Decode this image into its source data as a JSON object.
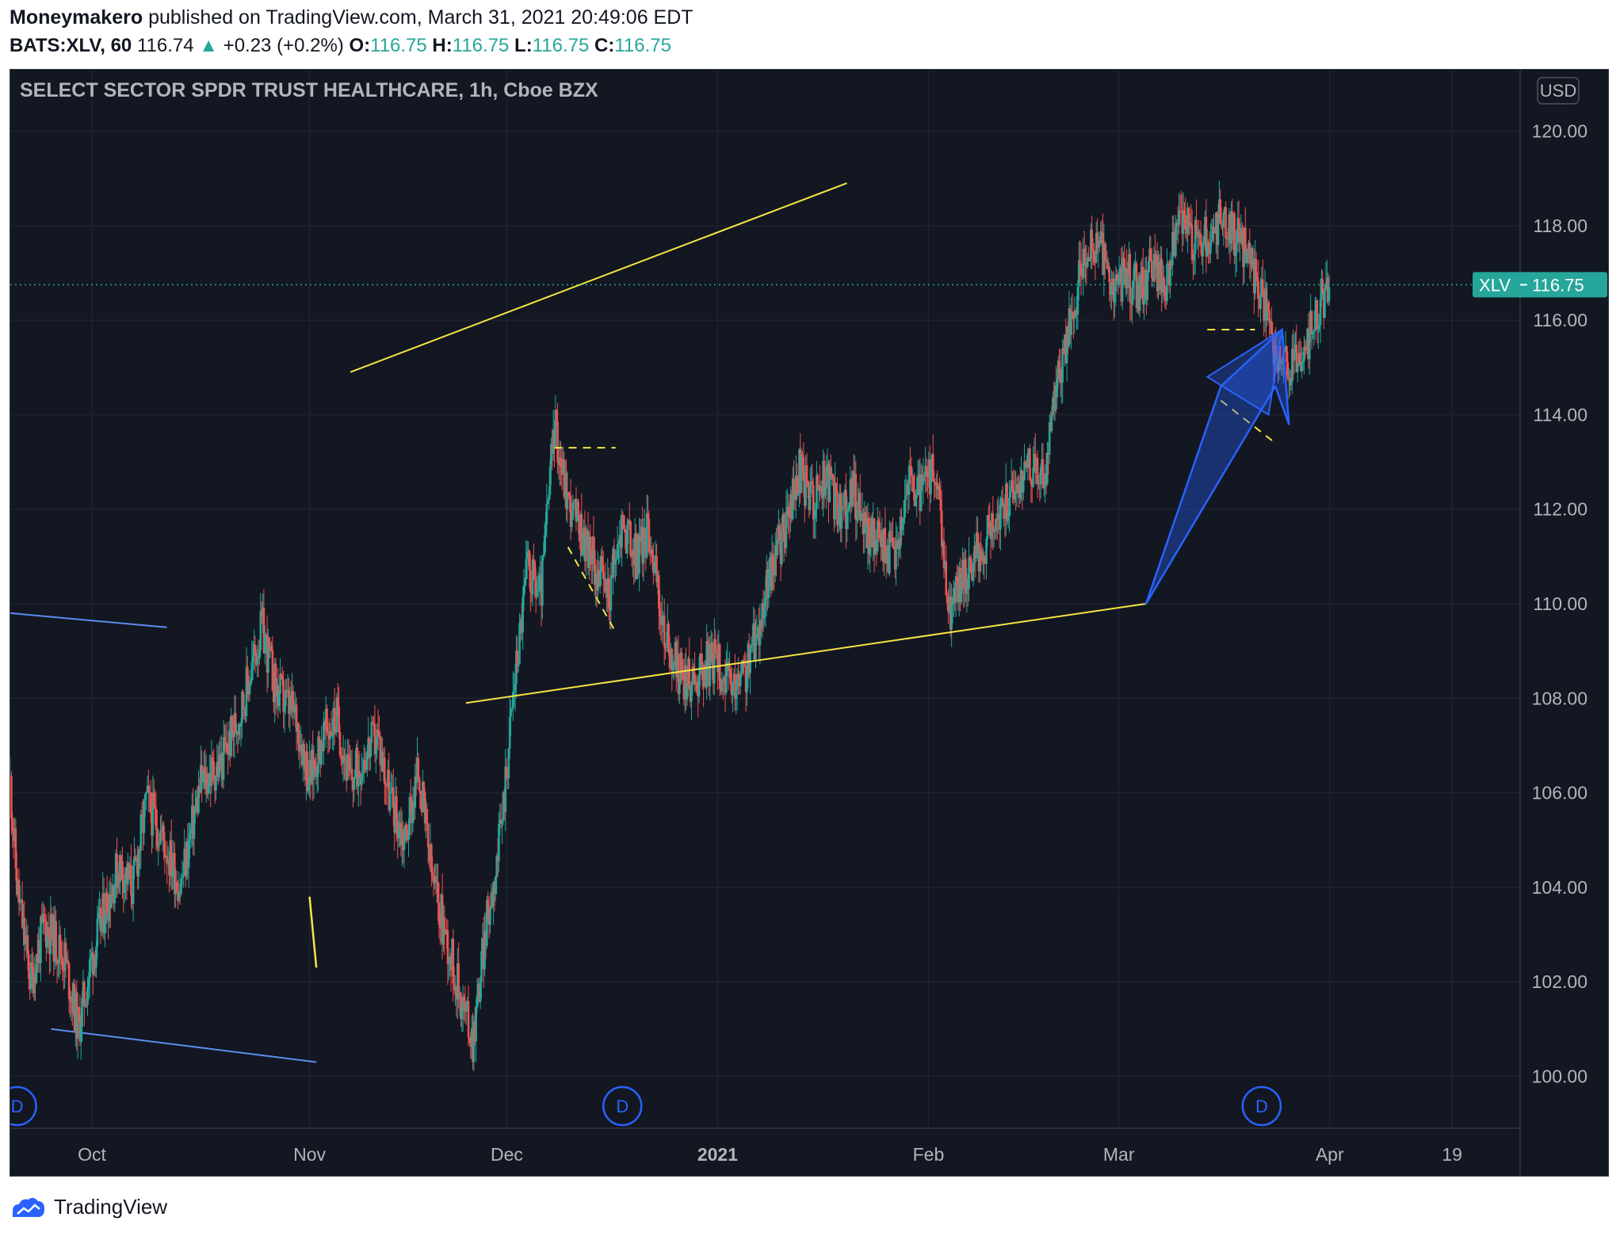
{
  "header": {
    "author": "Moneymakero",
    "published_text": "published on TradingView.com, March 31, 2021 20:49:06 EDT",
    "symbol": "BATS:XLV, 60",
    "last_price": "116.74",
    "change": "+0.23 (+0.2%)",
    "o_label": "O:",
    "o_value": "116.75",
    "h_label": "H:",
    "h_value": "116.75",
    "l_label": "L:",
    "l_value": "116.75",
    "c_label": "C:",
    "c_value": "116.75"
  },
  "footer": {
    "brand": "TradingView"
  },
  "colors": {
    "background": "#131722",
    "grid": "#1f2330",
    "up": "#26a69a",
    "down": "#ef5350",
    "trendline": "#f5e642",
    "channel": "#5b8def",
    "arrow": "#2962ff",
    "axis_text": "#b2b5be"
  },
  "chart_data": {
    "type": "candlestick",
    "title": "SELECT SECTOR SPDR TRUST HEALTHCARE, 1h, Cboe BZX",
    "currency": "USD",
    "y_ticks": [
      "100.00",
      "102.00",
      "104.00",
      "106.00",
      "108.00",
      "110.00",
      "112.00",
      "114.00",
      "116.00",
      "118.00",
      "120.00"
    ],
    "ylim": [
      98.9,
      121.3
    ],
    "x_ticks": [
      {
        "label": "Oct",
        "date": "2020-10-01"
      },
      {
        "label": "Nov",
        "date": "2020-11-02"
      },
      {
        "label": "Dec",
        "date": "2020-12-01"
      },
      {
        "label": "2021",
        "date": "2021-01-01",
        "bold": true
      },
      {
        "label": "Feb",
        "date": "2021-02-01"
      },
      {
        "label": "Mar",
        "date": "2021-03-01"
      },
      {
        "label": "Apr",
        "date": "2021-04-01"
      },
      {
        "label": "19",
        "date": "2021-04-19"
      }
    ],
    "xlim": [
      "2020-09-19",
      "2021-04-29"
    ],
    "last_price_label": {
      "symbol": "XLV",
      "value": "116.75",
      "price": 116.75
    },
    "dividend_markers": [
      {
        "label": "D",
        "date": "2020-09-20"
      },
      {
        "label": "D",
        "date": "2020-12-18"
      },
      {
        "label": "D",
        "date": "2021-03-22"
      }
    ],
    "price_path": [
      [
        "2020-09-19",
        106.2
      ],
      [
        "2020-09-20",
        104.0
      ],
      [
        "2020-09-22",
        102.0
      ],
      [
        "2020-09-24",
        103.2
      ],
      [
        "2020-09-25",
        103.0
      ],
      [
        "2020-09-27",
        102.5
      ],
      [
        "2020-09-29",
        101.0
      ],
      [
        "2020-10-01",
        102.5
      ],
      [
        "2020-10-03",
        103.6
      ],
      [
        "2020-10-05",
        104.5
      ],
      [
        "2020-10-07",
        104.0
      ],
      [
        "2020-10-09",
        105.8
      ],
      [
        "2020-10-11",
        105.2
      ],
      [
        "2020-10-14",
        104.0
      ],
      [
        "2020-10-17",
        106.2
      ],
      [
        "2020-10-20",
        106.6
      ],
      [
        "2020-10-23",
        107.8
      ],
      [
        "2020-10-26",
        109.5
      ],
      [
        "2020-10-28",
        108.2
      ],
      [
        "2020-10-31",
        107.6
      ],
      [
        "2020-11-02",
        106.3
      ],
      [
        "2020-11-04",
        107.2
      ],
      [
        "2020-11-06",
        107.6
      ],
      [
        "2020-11-08",
        106.2
      ],
      [
        "2020-11-10",
        106.8
      ],
      [
        "2020-11-12",
        107.2
      ],
      [
        "2020-11-14",
        105.8
      ],
      [
        "2020-11-16",
        105.0
      ],
      [
        "2020-11-18",
        106.5
      ],
      [
        "2020-11-20",
        104.2
      ],
      [
        "2020-11-22",
        103.0
      ],
      [
        "2020-11-24",
        101.8
      ],
      [
        "2020-11-26",
        100.8
      ],
      [
        "2020-11-28",
        103.2
      ],
      [
        "2020-11-30",
        105.0
      ],
      [
        "2020-12-02",
        108.2
      ],
      [
        "2020-12-04",
        110.8
      ],
      [
        "2020-12-06",
        110.2
      ],
      [
        "2020-12-08",
        113.8
      ],
      [
        "2020-12-10",
        112.2
      ],
      [
        "2020-12-12",
        111.5
      ],
      [
        "2020-12-14",
        110.8
      ],
      [
        "2020-12-16",
        110.2
      ],
      [
        "2020-12-18",
        111.7
      ],
      [
        "2020-12-20",
        111.0
      ],
      [
        "2020-12-22",
        111.6
      ],
      [
        "2020-12-24",
        109.4
      ],
      [
        "2020-12-26",
        108.6
      ],
      [
        "2020-12-28",
        108.3
      ],
      [
        "2020-12-30",
        108.7
      ],
      [
        "2021-01-01",
        108.8
      ],
      [
        "2021-01-03",
        108.1
      ],
      [
        "2021-01-05",
        108.5
      ],
      [
        "2021-01-07",
        109.5
      ],
      [
        "2021-01-09",
        110.8
      ],
      [
        "2021-01-11",
        111.6
      ],
      [
        "2021-01-13",
        112.8
      ],
      [
        "2021-01-15",
        112.2
      ],
      [
        "2021-01-17",
        112.7
      ],
      [
        "2021-01-19",
        111.8
      ],
      [
        "2021-01-21",
        112.4
      ],
      [
        "2021-01-23",
        111.5
      ],
      [
        "2021-01-25",
        111.3
      ],
      [
        "2021-01-27",
        111.0
      ],
      [
        "2021-01-29",
        112.6
      ],
      [
        "2021-01-31",
        112.3
      ],
      [
        "2021-02-02",
        112.8
      ],
      [
        "2021-02-04",
        109.8
      ],
      [
        "2021-02-06",
        110.6
      ],
      [
        "2021-02-08",
        111.0
      ],
      [
        "2021-02-10",
        111.5
      ],
      [
        "2021-02-12",
        112.0
      ],
      [
        "2021-02-14",
        112.5
      ],
      [
        "2021-02-16",
        113.0
      ],
      [
        "2021-02-18",
        112.5
      ],
      [
        "2021-02-20",
        114.8
      ],
      [
        "2021-02-22",
        116.0
      ],
      [
        "2021-02-24",
        117.5
      ],
      [
        "2021-02-26",
        117.6
      ],
      [
        "2021-02-28",
        116.6
      ],
      [
        "2021-03-02",
        117.0
      ],
      [
        "2021-03-04",
        116.6
      ],
      [
        "2021-03-06",
        117.2
      ],
      [
        "2021-03-08",
        116.8
      ],
      [
        "2021-03-10",
        118.2
      ],
      [
        "2021-03-12",
        117.7
      ],
      [
        "2021-03-14",
        117.7
      ],
      [
        "2021-03-16",
        118.2
      ],
      [
        "2021-03-18",
        117.8
      ],
      [
        "2021-03-20",
        117.5
      ],
      [
        "2021-03-22",
        116.5
      ],
      [
        "2021-03-24",
        115.2
      ],
      [
        "2021-03-26",
        115.0
      ],
      [
        "2021-03-28",
        115.0
      ],
      [
        "2021-03-30",
        116.2
      ],
      [
        "2021-04-01",
        116.7
      ]
    ]
  }
}
